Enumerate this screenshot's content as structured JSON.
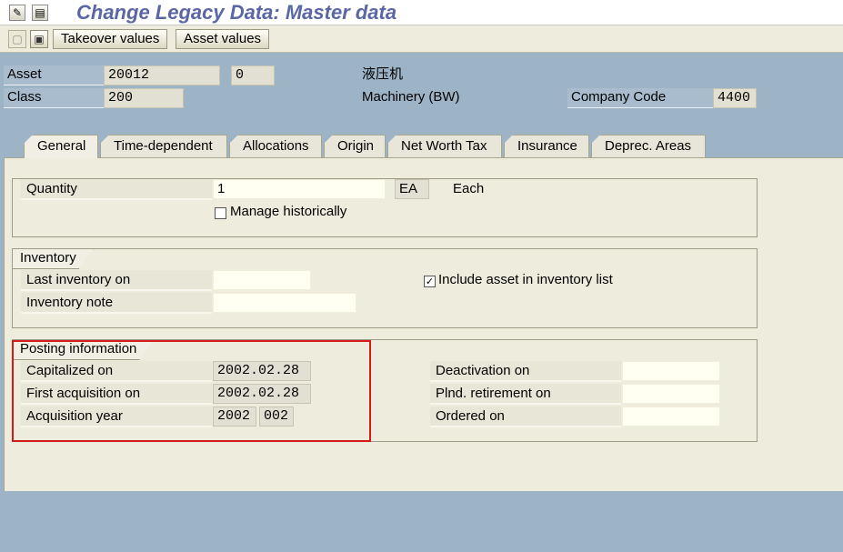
{
  "window": {
    "title": "Change Legacy Data: Master data",
    "icons": [
      "display-change-icon",
      "copy-icon"
    ]
  },
  "toolbar": {
    "buttons": [
      {
        "label": "Takeover values"
      },
      {
        "label": "Asset values"
      }
    ],
    "icons": [
      "disabled-doc-icon",
      "doc-icon"
    ]
  },
  "header": {
    "asset_label": "Asset",
    "asset_number": "20012",
    "asset_subnumber": "0",
    "asset_description": "液压机",
    "class_label": "Class",
    "class_value": "200",
    "class_description": "Machinery (BW)",
    "company_code_label": "Company Code",
    "company_code_value": "4400"
  },
  "tabs": [
    {
      "label": "General",
      "active": true
    },
    {
      "label": "Time-dependent"
    },
    {
      "label": "Allocations"
    },
    {
      "label": "Origin"
    },
    {
      "label": "Net Worth Tax"
    },
    {
      "label": "Insurance"
    },
    {
      "label": "Deprec. Areas"
    }
  ],
  "general": {
    "quantity_label": "Quantity",
    "quantity_value": "1",
    "unit": "EA",
    "unit_text": "Each",
    "manage_historically_label": "Manage historically",
    "manage_historically_checked": false
  },
  "inventory": {
    "title": "Inventory",
    "last_inventory_label": "Last inventory on",
    "last_inventory_value": "",
    "inventory_note_label": "Inventory note",
    "inventory_note_value": "",
    "include_label": "Include asset in inventory list",
    "include_checked": true
  },
  "posting": {
    "title": "Posting information",
    "capitalized_label": "Capitalized on",
    "capitalized_value": "2002.02.28",
    "first_acq_label": "First acquisition on",
    "first_acq_value": "2002.02.28",
    "acq_year_label": "Acquisition year",
    "acq_year_value": "2002",
    "acq_period_value": "002",
    "deactivation_label": "Deactivation on",
    "deactivation_value": "",
    "retirement_label": "Plnd. retirement on",
    "retirement_value": "",
    "ordered_label": "Ordered on",
    "ordered_value": ""
  },
  "colors": {
    "background": "#9db3c6",
    "panel": "#eeecdc",
    "title": "#5a67a4",
    "highlight": "#d21a1a"
  }
}
